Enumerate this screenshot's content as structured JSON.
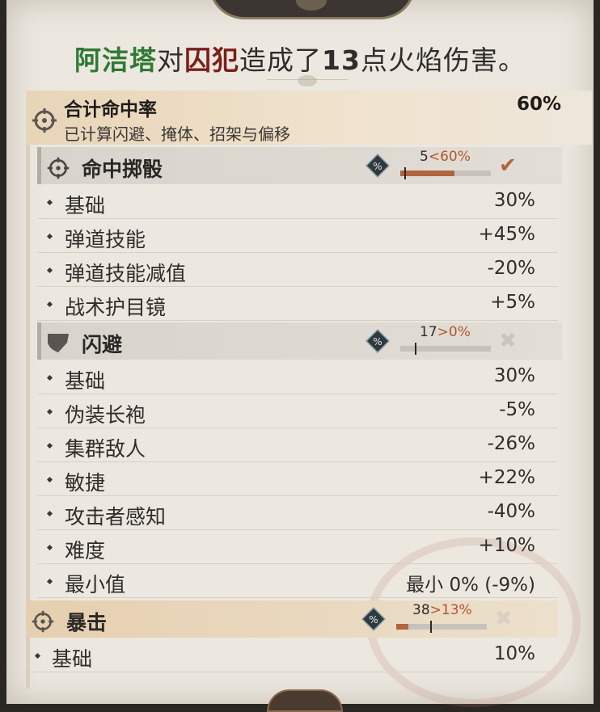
{
  "header": {
    "actor": "阿洁塔",
    "word_against": "对",
    "target": "囚犯",
    "action": "造成了",
    "amount": "13",
    "suffix": "点火焰伤害。"
  },
  "total": {
    "title": "合计命中率",
    "subtitle": "已计算闪避、掩体、招架与偏移",
    "value": "60%",
    "icon": "crosshair-icon"
  },
  "hit_roll": {
    "title": "命中掷骰",
    "icon": "crosshair-icon",
    "roll": "5",
    "comparator": "<60%",
    "roll_fraction": 0.05,
    "threshold_fraction": 0.6,
    "result_icon": "check-icon",
    "rows": [
      {
        "label": "基础",
        "value": "30%"
      },
      {
        "label": "弹道技能",
        "value": "+45%"
      },
      {
        "label": "弹道技能减值",
        "value": "-20%"
      },
      {
        "label": "战术护目镜",
        "value": "+5%"
      }
    ]
  },
  "dodge": {
    "title": "闪避",
    "icon": "shield-icon",
    "roll": "17",
    "comparator": ">0%",
    "roll_fraction": 0.17,
    "threshold_fraction": 0.0,
    "result_icon": "cross-icon",
    "rows": [
      {
        "label": "基础",
        "value": "30%"
      },
      {
        "label": "伪装长袍",
        "value": "-5%"
      },
      {
        "label": "集群敌人",
        "value": "-26%"
      },
      {
        "label": "敏捷",
        "value": "+22%"
      },
      {
        "label": "攻击者感知",
        "value": "-40%"
      },
      {
        "label": "难度",
        "value": "+10%"
      },
      {
        "label": "最小值",
        "value": "最小 0% (-9%)"
      }
    ]
  },
  "crit": {
    "title": "暴击",
    "icon": "crosshair-icon",
    "roll": "38",
    "comparator": ">13%",
    "roll_fraction": 0.38,
    "threshold_fraction": 0.13,
    "result_icon": "cross-icon",
    "rows": [
      {
        "label": "基础",
        "value": "10%"
      }
    ]
  },
  "colors": {
    "actor": "#2e7a35",
    "target": "#7a1f1a",
    "accent": "#b5552e"
  }
}
